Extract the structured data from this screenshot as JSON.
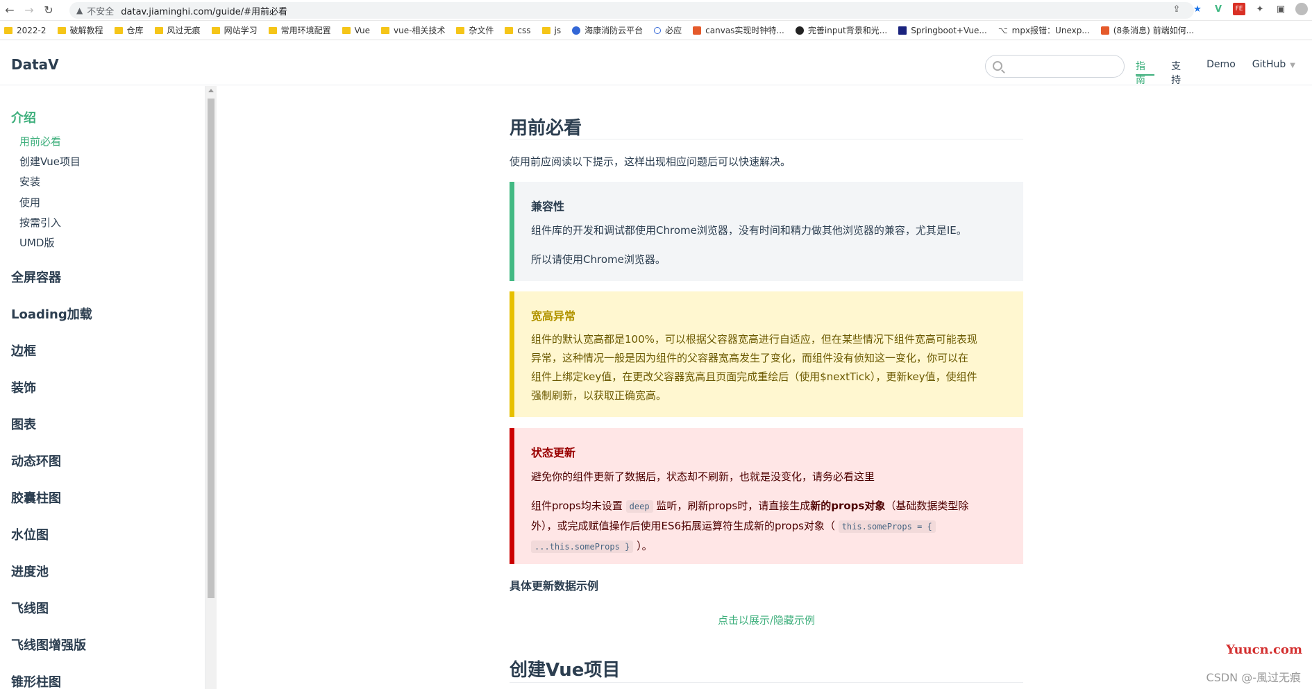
{
  "browser": {
    "insecure_label": "不安全",
    "url": "datav.jiaminghi.com/guide/#用前必看"
  },
  "bookmarks": [
    {
      "label": "2022-2",
      "icon": "folder"
    },
    {
      "label": "破解教程",
      "icon": "folder"
    },
    {
      "label": "仓库",
      "icon": "folder"
    },
    {
      "label": "风过无痕",
      "icon": "folder"
    },
    {
      "label": "网站学习",
      "icon": "folder"
    },
    {
      "label": "常用环境配置",
      "icon": "folder"
    },
    {
      "label": "Vue",
      "icon": "folder"
    },
    {
      "label": "vue-相关技术",
      "icon": "folder"
    },
    {
      "label": "杂文件",
      "icon": "folder"
    },
    {
      "label": "css",
      "icon": "folder"
    },
    {
      "label": "js",
      "icon": "folder"
    },
    {
      "label": "海康消防云平台",
      "icon": "blue"
    },
    {
      "label": "必应",
      "icon": "search"
    },
    {
      "label": "canvas实现时钟特...",
      "icon": "csdn"
    },
    {
      "label": "完善input背景和光...",
      "icon": "github"
    },
    {
      "label": "Springboot+Vue...",
      "icon": "r"
    },
    {
      "label": "mpx报错：Unexp...",
      "icon": "mpx"
    },
    {
      "label": "(8条消息) 前端如何...",
      "icon": "csdn"
    }
  ],
  "site": {
    "logo": "DataV",
    "search_placeholder": "",
    "nav": [
      {
        "label": "指南",
        "active": true
      },
      {
        "label": "支持",
        "active": false
      },
      {
        "label": "Demo",
        "active": false
      },
      {
        "label": "GitHub",
        "active": false
      }
    ]
  },
  "sidebar": {
    "groups": [
      {
        "title": "介绍",
        "active": true
      },
      {
        "title": "全屏容器"
      },
      {
        "title": "Loading加载"
      },
      {
        "title": "边框"
      },
      {
        "title": "装饰"
      },
      {
        "title": "图表"
      },
      {
        "title": "动态环图"
      },
      {
        "title": "胶囊柱图"
      },
      {
        "title": "水位图"
      },
      {
        "title": "进度池"
      },
      {
        "title": "飞线图"
      },
      {
        "title": "飞线图增强版"
      },
      {
        "title": "锥形柱图"
      }
    ],
    "sub_items": [
      {
        "label": "用前必看",
        "active": true
      },
      {
        "label": "创建Vue项目"
      },
      {
        "label": "安装"
      },
      {
        "label": "使用"
      },
      {
        "label": "按需引入"
      },
      {
        "label": "UMD版"
      }
    ]
  },
  "content": {
    "title": "用前必看",
    "intro": "使用前应阅读以下提示，这样出现相应问题后可以快速解决。",
    "tip": {
      "title": "兼容性",
      "p1": "组件库的开发和调试都使用Chrome浏览器，没有时间和精力做其他浏览器的兼容，尤其是IE。",
      "p2": "所以请使用Chrome浏览器。"
    },
    "warning": {
      "title": "宽高异常",
      "line1": "组件的默认宽高都是100%，可以根据父容器宽高进行自适应，但在某些情况下组件宽高可能表现",
      "line2": "异常，这种情况一般是因为组件的父容器宽高发生了变化，而组件没有侦知这一变化，你可以在",
      "line3": "组件上绑定key值，在更改父容器宽高且页面完成重绘后（使用$nextTick），更新key值，使组件",
      "line4": "强制刷新，以获取正确宽高。"
    },
    "danger": {
      "title": "状态更新",
      "p1": "避免你的组件更新了数据后，状态却不刷新，也就是没变化，请务必看这里",
      "p2_a": "组件props均未设置",
      "p2_code1": "deep",
      "p2_b": "监听，刷新props时，请直接生成",
      "p2_strong": "新的props对象",
      "p2_c": "（基础数据类型除",
      "p2_d": "外），或完成赋值操作后使用ES6拓展运算符生成新的props对象（",
      "p2_code2": "this.someProps = {",
      "p2_code3": "...this.someProps }",
      "p2_e": "）。"
    },
    "example_title": "具体更新数据示例",
    "toggle_example": "点击以展示/隐藏示例",
    "next_title": "创建Vue项目"
  },
  "watermark": "Yuucn.com",
  "csdn_mark": "CSDN @-風过无痕"
}
